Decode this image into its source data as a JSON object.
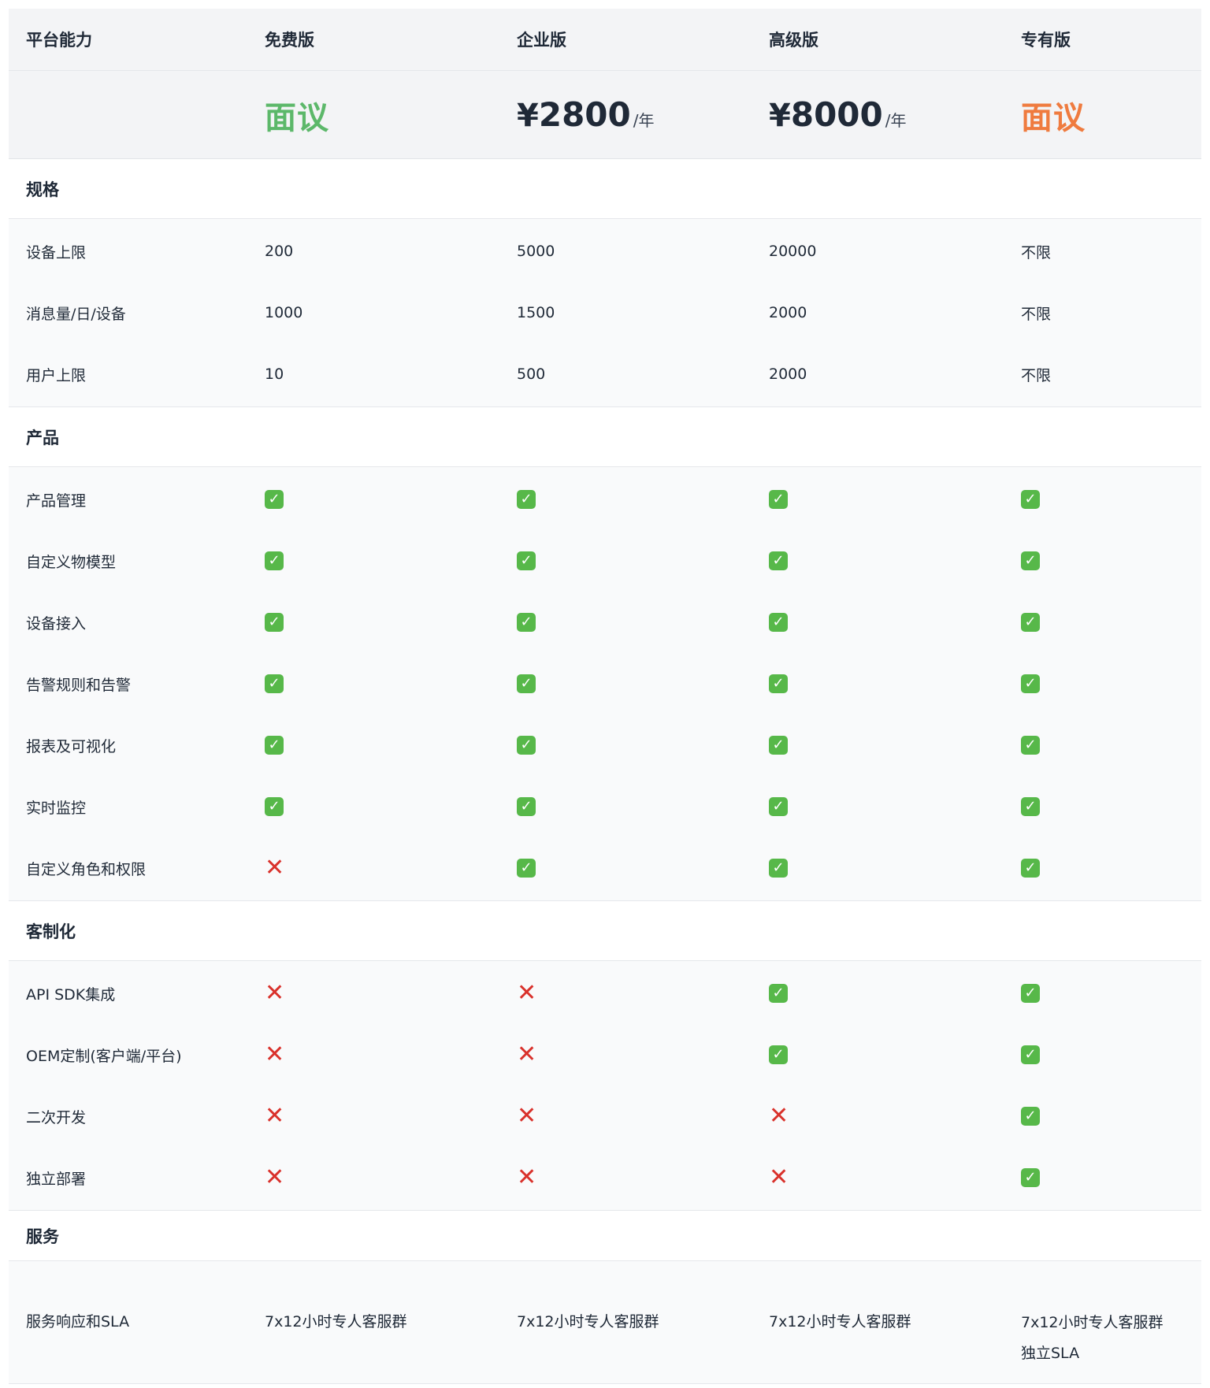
{
  "header": {
    "capability": "平台能力",
    "plans": [
      "免费版",
      "企业版",
      "高级版",
      "专有版"
    ]
  },
  "pricing": {
    "free": "面议",
    "enterprise": {
      "yen": "¥",
      "amount": "2800",
      "unit": "/年"
    },
    "advanced": {
      "yen": "¥",
      "amount": "8000",
      "unit": "/年"
    },
    "dedicated": "面议",
    "colors": {
      "green": "#5cb86a",
      "orange": "#ef7b3f"
    }
  },
  "sections": {
    "spec": {
      "title": "规格",
      "rows": [
        {
          "label": "设备上限",
          "values": [
            "200",
            "5000",
            "20000",
            "不限"
          ]
        },
        {
          "label": "消息量/日/设备",
          "values": [
            "1000",
            "1500",
            "2000",
            "不限"
          ]
        },
        {
          "label": "用户上限",
          "values": [
            "10",
            "500",
            "2000",
            "不限"
          ]
        }
      ]
    },
    "product": {
      "title": "产品",
      "rows": [
        {
          "label": "产品管理",
          "values": [
            true,
            true,
            true,
            true
          ]
        },
        {
          "label": "自定义物模型",
          "values": [
            true,
            true,
            true,
            true
          ]
        },
        {
          "label": "设备接入",
          "values": [
            true,
            true,
            true,
            true
          ]
        },
        {
          "label": "告警规则和告警",
          "values": [
            true,
            true,
            true,
            true
          ]
        },
        {
          "label": "报表及可视化",
          "values": [
            true,
            true,
            true,
            true
          ]
        },
        {
          "label": "实时监控",
          "values": [
            true,
            true,
            true,
            true
          ]
        },
        {
          "label": "自定义角色和权限",
          "values": [
            false,
            true,
            true,
            true
          ]
        }
      ]
    },
    "custom": {
      "title": "客制化",
      "rows": [
        {
          "label": "API SDK集成",
          "values": [
            false,
            false,
            true,
            true
          ]
        },
        {
          "label": "OEM定制(客户端/平台)",
          "values": [
            false,
            false,
            true,
            true
          ]
        },
        {
          "label": "二次开发",
          "values": [
            false,
            false,
            false,
            true
          ]
        },
        {
          "label": "独立部署",
          "values": [
            false,
            false,
            false,
            true
          ]
        }
      ]
    },
    "service": {
      "title": "服务",
      "row": {
        "label": "服务响应和SLA",
        "free": "7x12小时专人客服群",
        "enterprise": "7x12小时专人客服群",
        "advanced": "7x12小时专人客服群",
        "dedicated_line1": "7x12小时专人客服群",
        "dedicated_line2": "独立SLA"
      }
    }
  },
  "icons": {
    "yes": "check-icon",
    "no": "cross-icon"
  }
}
